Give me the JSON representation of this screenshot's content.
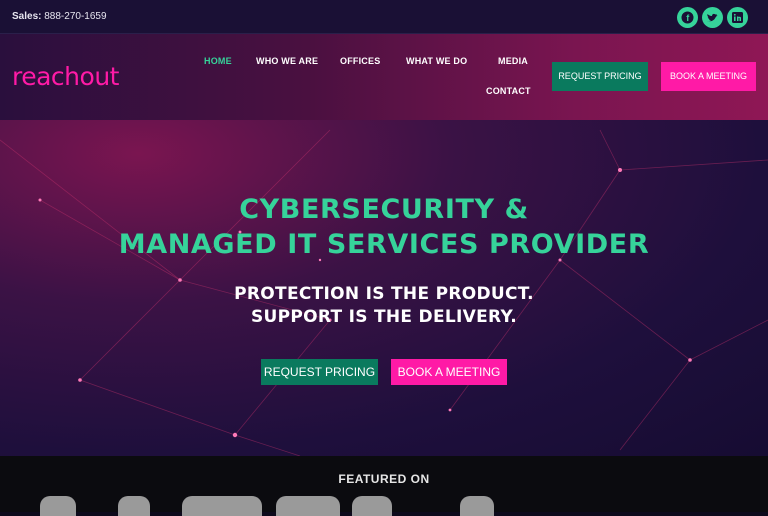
{
  "topbar": {
    "sales_label": "Sales:",
    "sales_phone": "888-270-1659",
    "socials": [
      {
        "icon": "facebook-icon",
        "glyph": "f"
      },
      {
        "icon": "twitter-icon",
        "glyph": "t"
      },
      {
        "icon": "linkedin-icon",
        "glyph": "in"
      }
    ]
  },
  "header": {
    "logo": "reachout",
    "nav": [
      {
        "label": "HOME",
        "active": true
      },
      {
        "label": "WHO WE ARE"
      },
      {
        "label": "OFFICES"
      },
      {
        "label": "WHAT WE DO"
      },
      {
        "label": "MEDIA"
      },
      {
        "label": "CONTACT"
      }
    ],
    "request_pricing": "REQUEST PRICING",
    "book_meeting": "BOOK A MEETING"
  },
  "hero": {
    "title_line1": "CYBERSECURITY &",
    "title_line2": "MANAGED IT SERVICES PROVIDER",
    "subtitle_line1": "PROTECTION IS THE PRODUCT.",
    "subtitle_line2": "SUPPORT IS THE DELIVERY.",
    "request_pricing": "REQUEST PRICING",
    "book_meeting": "BOOK A MEETING"
  },
  "featured": {
    "title": "FEATURED ON"
  },
  "colors": {
    "accent_green": "#36d39a",
    "button_green": "#0a7a5e",
    "accent_pink": "#ff1aa6"
  }
}
